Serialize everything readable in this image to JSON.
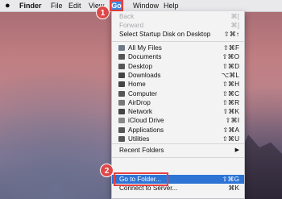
{
  "menubar": {
    "apple": "",
    "finder": "Finder",
    "file": "File",
    "edit": "Edit",
    "view": "View",
    "go": "Go",
    "window": "Window",
    "help": "Help"
  },
  "badges": {
    "one": "1",
    "two": "2"
  },
  "go_menu": {
    "back": {
      "label": "Back",
      "shortcut": "⌘["
    },
    "forward": {
      "label": "Forward",
      "shortcut": "⌘]"
    },
    "startup": {
      "label": "Select Startup Disk on Desktop",
      "shortcut": "⇧⌘↑"
    },
    "places": [
      {
        "label": "All My Files",
        "shortcut": "⇧⌘F",
        "icon": "all-files-icon",
        "color": "#6f7a86"
      },
      {
        "label": "Documents",
        "shortcut": "⇧⌘O",
        "icon": "documents-icon",
        "color": "#555"
      },
      {
        "label": "Desktop",
        "shortcut": "⇧⌘D",
        "icon": "desktop-icon",
        "color": "#555"
      },
      {
        "label": "Downloads",
        "shortcut": "⌥⌘L",
        "icon": "downloads-icon",
        "color": "#444"
      },
      {
        "label": "Home",
        "shortcut": "⇧⌘H",
        "icon": "home-icon",
        "color": "#444"
      },
      {
        "label": "Computer",
        "shortcut": "⇧⌘C",
        "icon": "computer-icon",
        "color": "#555"
      },
      {
        "label": "AirDrop",
        "shortcut": "⇧⌘R",
        "icon": "airdrop-icon",
        "color": "#777"
      },
      {
        "label": "Network",
        "shortcut": "⇧⌘K",
        "icon": "network-icon",
        "color": "#444"
      },
      {
        "label": "iCloud Drive",
        "shortcut": "⇧⌘I",
        "icon": "icloud-icon",
        "color": "#888"
      },
      {
        "label": "Applications",
        "shortcut": "⇧⌘A",
        "icon": "applications-icon",
        "color": "#555"
      },
      {
        "label": "Utilities",
        "shortcut": "⇧⌘U",
        "icon": "utilities-icon",
        "color": "#555"
      }
    ],
    "recent_folders": {
      "label": "Recent Folders",
      "arrow": "▶"
    },
    "go_to_folder": {
      "label": "Go to Folder...",
      "shortcut": "⇧⌘G"
    },
    "connect": {
      "label": "Connect to Server...",
      "shortcut": "⌘K"
    }
  },
  "colors": {
    "highlight": "#2e74d5",
    "annotation": "#e84040",
    "menubar": "#e9e8ea"
  }
}
